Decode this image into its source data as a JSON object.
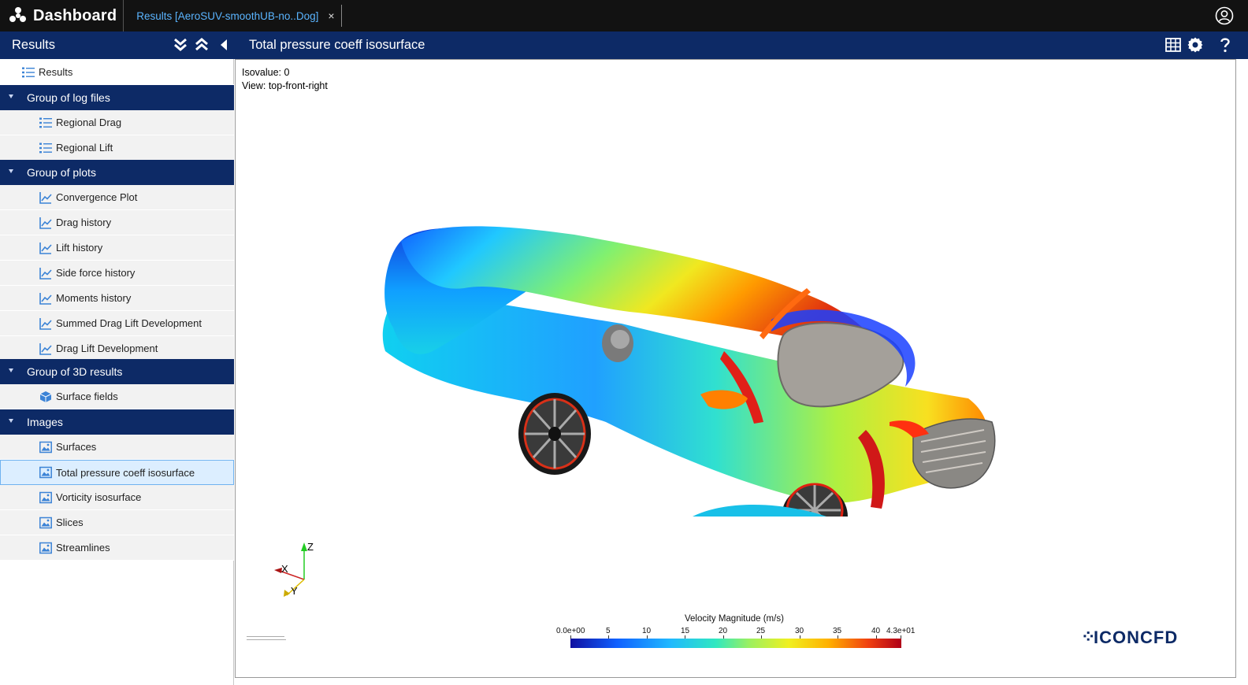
{
  "topbar": {
    "app_title": "Dashboard",
    "tab_label": "Results [AeroSUV-smoothUB-no..Dog]",
    "tab_close": "×"
  },
  "header": {
    "sidebar_title": "Results",
    "main_title": "Total pressure coeff isosurface"
  },
  "sidebar": {
    "root": "Results",
    "groups": [
      {
        "label": "Group of log files",
        "items": [
          "Regional Drag",
          "Regional Lift"
        ]
      },
      {
        "label": "Group of plots",
        "items": [
          "Convergence Plot",
          "Drag history",
          "Lift history",
          "Side force history",
          "Moments history",
          "Summed Drag Lift Development",
          "Drag Lift Development"
        ]
      },
      {
        "label": "Group of 3D results",
        "items": [
          "Surface fields"
        ]
      },
      {
        "label": "Images",
        "items": [
          "Surfaces",
          "Total pressure coeff isosurface",
          "Vorticity isosurface",
          "Slices",
          "Streamlines"
        ]
      }
    ],
    "selected": "Total pressure coeff isosurface"
  },
  "viewer": {
    "isovalue": "Isovalue: 0",
    "view": "View: top-front-right",
    "axis_labels": {
      "x": "X",
      "y": "Y",
      "z": "Z"
    },
    "legend": {
      "title": "Velocity Magnitude (m/s)",
      "ticks": [
        "0.0e+00",
        "5",
        "10",
        "15",
        "20",
        "25",
        "30",
        "35",
        "40",
        "4.3e+01"
      ],
      "min": 0,
      "max": 43
    },
    "logo_text": "ICONCFD"
  },
  "colors": {
    "topbar": "#121212",
    "header": "#0d2a66",
    "tab_link": "#5ab4ff",
    "selection": "#dceeff"
  }
}
